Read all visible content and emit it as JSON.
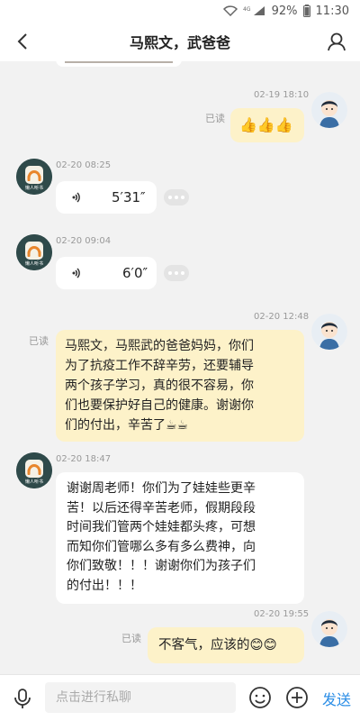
{
  "status_bar": {
    "battery": "92%",
    "time": "11:30"
  },
  "header": {
    "title": "马熙文，武爸爸"
  },
  "messages": [
    {
      "time": "02-19 18:10",
      "read": "已读",
      "text": "👍👍👍"
    },
    {
      "time": "02-20 08:25",
      "duration": "5′31″"
    },
    {
      "time": "02-20 09:04",
      "duration": "6′0″"
    },
    {
      "time": "02-20 12:48",
      "read": "已读",
      "lines": [
        "马熙文，马熙武的爸爸妈妈，你们",
        "为了抗疫工作不辞辛劳，还要辅导",
        "两个孩子学习，真的很不容易，你",
        "们也要保护好自己的健康。谢谢你",
        "们的付出，辛苦了☕☕"
      ]
    },
    {
      "time": "02-20 18:47",
      "lines": [
        "谢谢周老师！你们为了娃娃些更辛",
        "苦！以后还得辛苦老师，假期段段",
        "时间我们管两个娃娃都头疼，可想",
        "而知你们管哪么多有多么费神，向",
        "你们致敬！！！谢谢你们为孩子们",
        "的付出！！！"
      ]
    },
    {
      "time": "02-20 19:55",
      "read": "已读",
      "text": "不客气，应该的😊😊"
    }
  ],
  "avatar_label": "懒人听书",
  "input": {
    "placeholder": "点击进行私聊",
    "send_label": "发送"
  },
  "colors": {
    "outgoing_bubble": "#fdf2c9",
    "incoming_bubble": "#ffffff",
    "send": "#2a8de6"
  }
}
